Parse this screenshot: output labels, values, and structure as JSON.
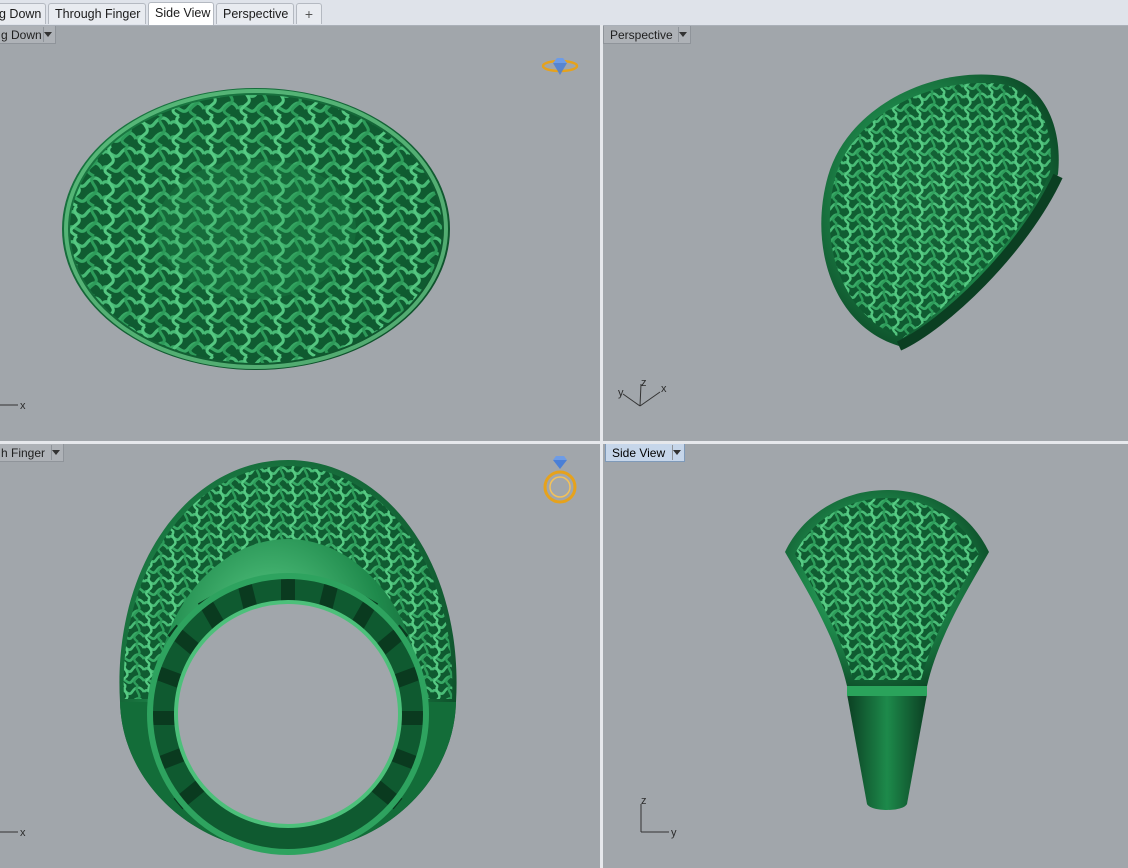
{
  "tabs": [
    {
      "label": "g Down",
      "active": false
    },
    {
      "label": "Through Finger",
      "active": false
    },
    {
      "label": "Side View",
      "active": true
    },
    {
      "label": "Perspective",
      "active": false
    },
    {
      "label": "+",
      "active": false
    }
  ],
  "viewports": {
    "top_left": {
      "title": "g Down",
      "axis_x": "x",
      "icon": "ring-top-icon"
    },
    "top_right": {
      "title": "Perspective",
      "axis_x": "x",
      "axis_y": "y",
      "axis_z": "z"
    },
    "bottom_left": {
      "title": "h Finger",
      "axis_x": "x",
      "icon": "ring-front-icon"
    },
    "bottom_right": {
      "title": "Side View",
      "axis_y": "y",
      "axis_z": "z",
      "active": true
    }
  },
  "colors": {
    "viewport_bg": "#a1a6ab",
    "ring_green": "#1f8a4c",
    "ring_light": "#6fd18f",
    "ring_dark": "#0d4a27",
    "icon_gold": "#e6a21c",
    "icon_blue": "#4a7fd6"
  }
}
